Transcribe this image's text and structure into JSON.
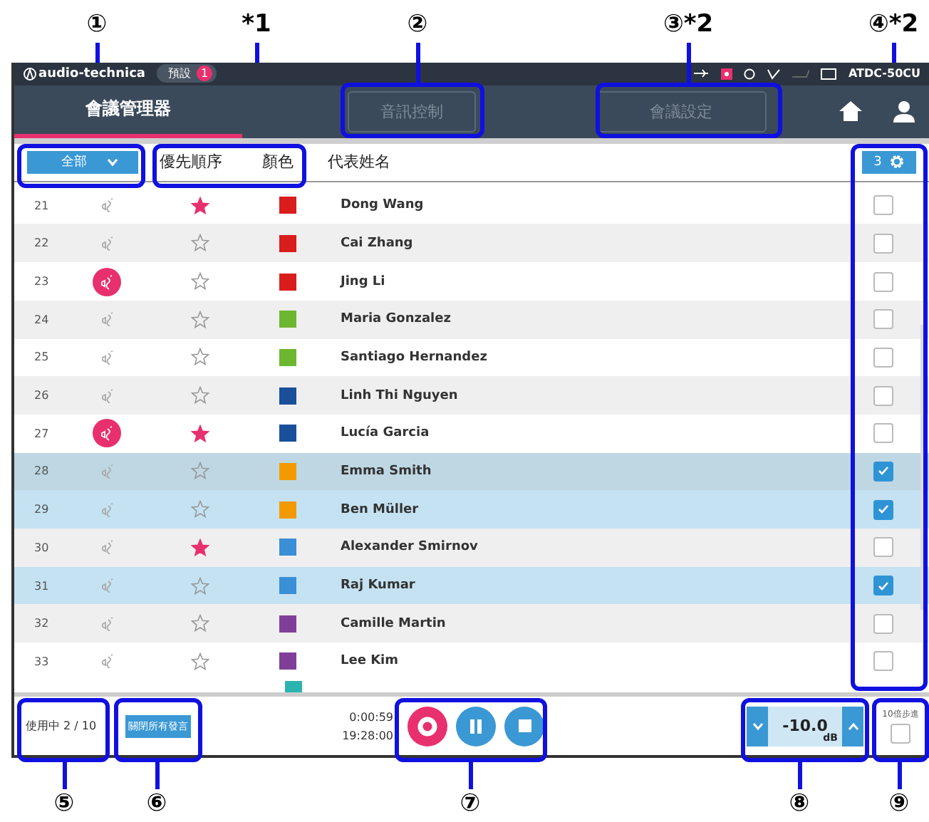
{
  "callouts_top": [
    {
      "label": "①"
    },
    {
      "label": "*1"
    },
    {
      "label": "②"
    },
    {
      "label": "③*2"
    },
    {
      "label": "④*2"
    }
  ],
  "callouts_bottom": [
    {
      "label": "⑤"
    },
    {
      "label": "⑥"
    },
    {
      "label": "⑦"
    },
    {
      "label": "⑧"
    },
    {
      "label": "⑨"
    }
  ],
  "top_bar": {
    "logo": "audio-technica",
    "preset": {
      "label": "預設",
      "count": "1"
    },
    "device": "ATDC-50CU"
  },
  "nav": [
    {
      "label": "會議管理器",
      "selected": true,
      "disabled": false
    },
    {
      "label": "音訊控制",
      "selected": false,
      "disabled": true
    },
    {
      "label": "會議設定",
      "selected": false,
      "disabled": true
    }
  ],
  "list": {
    "filter": "全部",
    "columns": [
      "優先順序",
      "顏色",
      "代表姓名"
    ],
    "selected_count": "3",
    "rows": [
      {
        "number": "21",
        "speaking": false,
        "priority": true,
        "color": "#d91c1c",
        "name": "Dong Wang",
        "checked": false,
        "focused": false
      },
      {
        "number": "22",
        "speaking": false,
        "priority": false,
        "color": "#d91c1c",
        "name": "Cai Zhang",
        "checked": false,
        "focused": false
      },
      {
        "number": "23",
        "speaking": true,
        "priority": false,
        "color": "#d91c1c",
        "name": "Jing Li",
        "checked": false,
        "focused": false
      },
      {
        "number": "24",
        "speaking": false,
        "priority": false,
        "color": "#6cb72f",
        "name": "Maria Gonzalez",
        "checked": false,
        "focused": false
      },
      {
        "number": "25",
        "speaking": false,
        "priority": false,
        "color": "#6cb72f",
        "name": "Santiago Hernandez",
        "checked": false,
        "focused": false
      },
      {
        "number": "26",
        "speaking": false,
        "priority": false,
        "color": "#1a4f9a",
        "name": "Linh Thi Nguyen",
        "checked": false,
        "focused": false
      },
      {
        "number": "27",
        "speaking": true,
        "priority": true,
        "color": "#1a4f9a",
        "name": "Lucía Garcia",
        "checked": false,
        "focused": false
      },
      {
        "number": "28",
        "speaking": false,
        "priority": false,
        "color": "#f39a00",
        "name": "Emma Smith",
        "checked": true,
        "focused": true
      },
      {
        "number": "29",
        "speaking": false,
        "priority": false,
        "color": "#f39a00",
        "name": "Ben Müller",
        "checked": true,
        "focused": false
      },
      {
        "number": "30",
        "speaking": false,
        "priority": true,
        "color": "#3a8fd6",
        "name": "Alexander Smirnov",
        "checked": false,
        "focused": false
      },
      {
        "number": "31",
        "speaking": false,
        "priority": false,
        "color": "#3a8fd6",
        "name": "Raj Kumar",
        "checked": true,
        "focused": false
      },
      {
        "number": "32",
        "speaking": false,
        "priority": false,
        "color": "#7f3f98",
        "name": "Camille Martin",
        "checked": false,
        "focused": false
      },
      {
        "number": "33",
        "speaking": false,
        "priority": false,
        "color": "#7f3f98",
        "name": "Lee Kim",
        "checked": false,
        "focused": false
      }
    ]
  },
  "footer": {
    "in_use": "使用中 2 / 10",
    "close_all": "關閉所有發言",
    "elapsed": "0:00:59",
    "clock": "19:28:00",
    "gain": "-10.0",
    "gain_unit": "dB",
    "step_label": "10倍步進",
    "step_checked": false
  }
}
